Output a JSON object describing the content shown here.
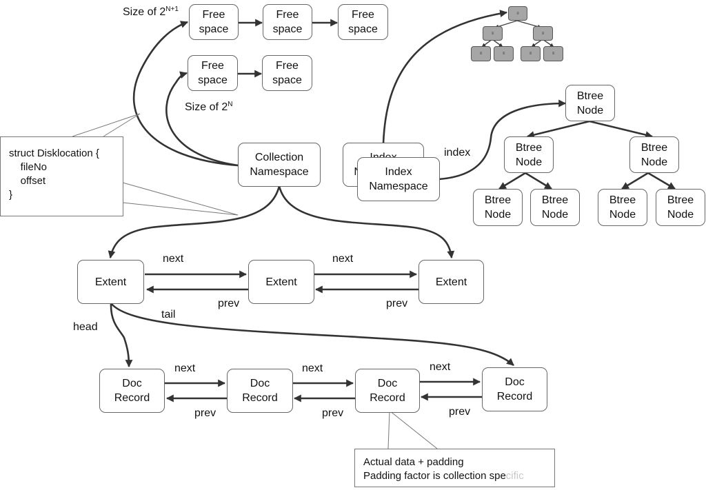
{
  "diagram": {
    "free_space_lists": {
      "large": {
        "label_prefix": "Size of 2",
        "label_exponent": "N+1",
        "nodes": [
          {
            "line1": "Free",
            "line2": "space"
          },
          {
            "line1": "Free",
            "line2": "space"
          },
          {
            "line1": "Free",
            "line2": "space"
          }
        ]
      },
      "small": {
        "label_prefix": "Size of 2",
        "label_exponent": "N",
        "nodes": [
          {
            "line1": "Free",
            "line2": "space"
          },
          {
            "line1": "Free",
            "line2": "space"
          }
        ]
      }
    },
    "mini_tree": {
      "node_glyph": "≡",
      "node_count": 7
    },
    "struct_callout": {
      "lines": [
        "struct Disklocation {",
        "    fileNo",
        "    offset",
        "}"
      ]
    },
    "collection_namespace": {
      "line1": "Collection",
      "line2": "Namespace"
    },
    "index_namespace_back": {
      "line1": "Index",
      "line2": "Namespace"
    },
    "index_namespace_front": {
      "line1": "Index",
      "line2": "Namespace"
    },
    "index_edge_label": "index",
    "btree": {
      "root": {
        "line1": "Btree",
        "line2": "Node"
      },
      "level1": [
        {
          "line1": "Btree",
          "line2": "Node"
        },
        {
          "line1": "Btree",
          "line2": "Node"
        }
      ],
      "level2": [
        {
          "line1": "Btree",
          "line2": "Node"
        },
        {
          "line1": "Btree",
          "line2": "Node"
        },
        {
          "line1": "Btree",
          "line2": "Node"
        },
        {
          "line1": "Btree",
          "line2": "Node"
        }
      ]
    },
    "extents": {
      "nodes": [
        "Extent",
        "Extent",
        "Extent"
      ],
      "next_labels": [
        "next",
        "next"
      ],
      "prev_labels": [
        "prev",
        "prev"
      ],
      "head_label": "head",
      "tail_label": "tail"
    },
    "doc_records": {
      "nodes": [
        {
          "line1": "Doc",
          "line2": "Record"
        },
        {
          "line1": "Doc",
          "line2": "Record"
        },
        {
          "line1": "Doc",
          "line2": "Record"
        },
        {
          "line1": "Doc",
          "line2": "Record"
        }
      ],
      "next_labels": [
        "next",
        "next",
        "next"
      ],
      "prev_labels": [
        "prev",
        "prev",
        "prev"
      ]
    },
    "padding_callout": {
      "line1": "Actual data + padding",
      "line2_main": "Padding factor is collection spe",
      "line2_faded": "cific"
    }
  }
}
